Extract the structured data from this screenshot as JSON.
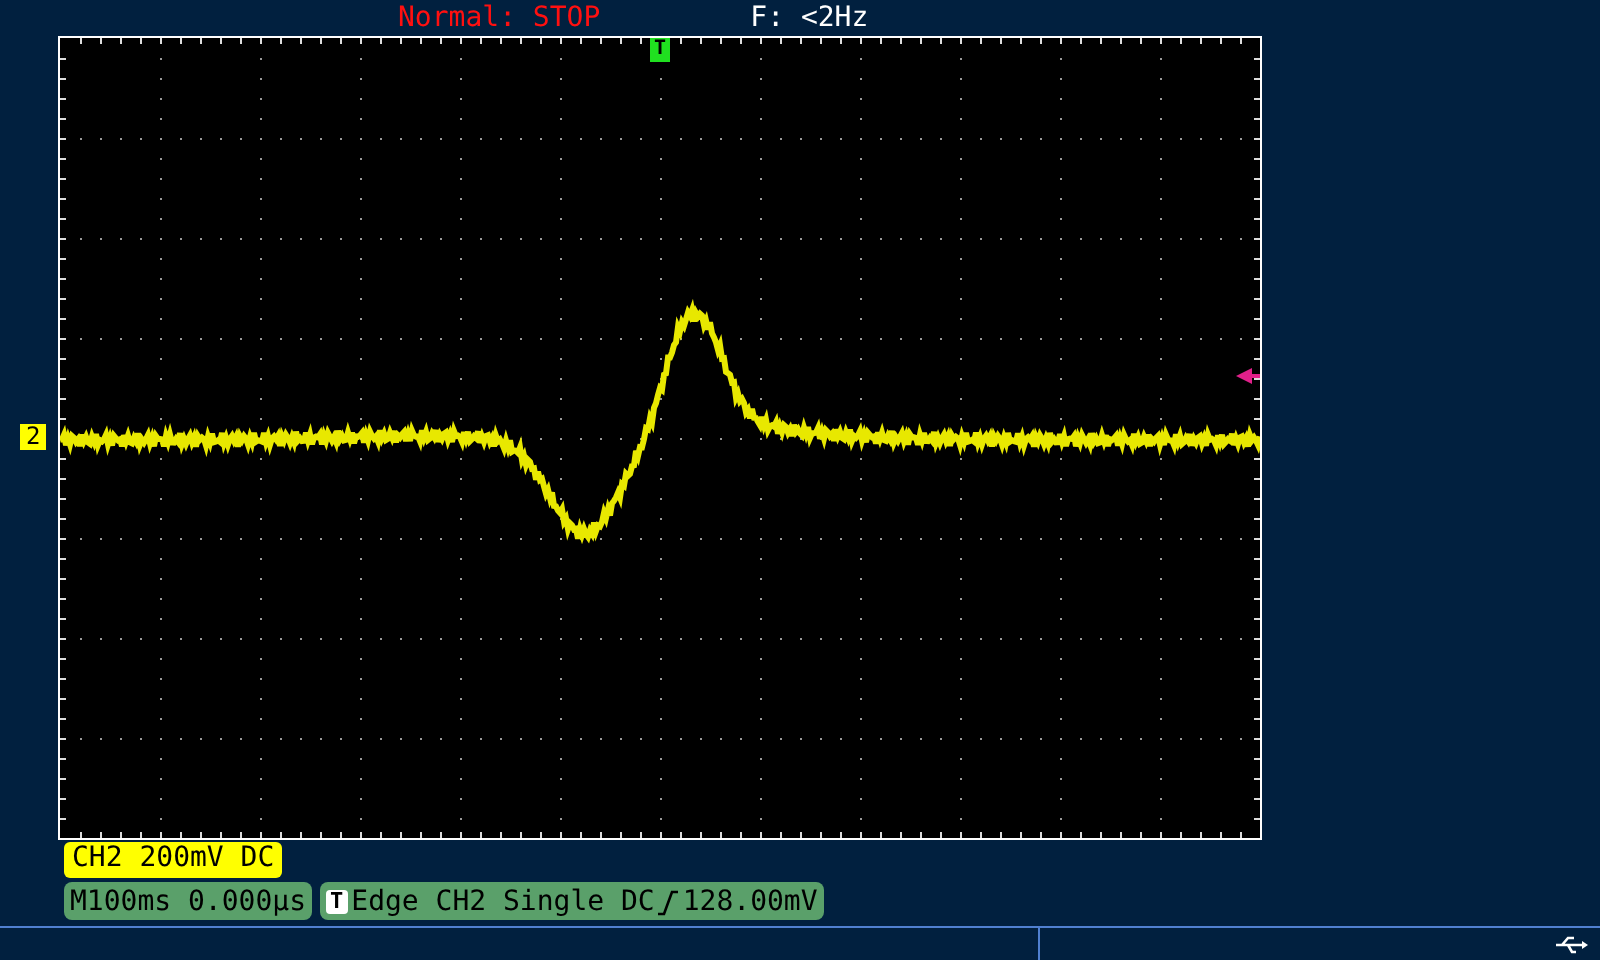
{
  "status": {
    "mode": "Normal: STOP",
    "frequency": "F: <2Hz"
  },
  "trigger_marker": "T",
  "channel_marker": "2",
  "channel_label": "CH2 200mV DC",
  "timebase": "M100ms 0.000µs",
  "trigger_info": {
    "icon": "T",
    "source": "Edge CH2 Single DC",
    "level": "128.00mV"
  }
}
